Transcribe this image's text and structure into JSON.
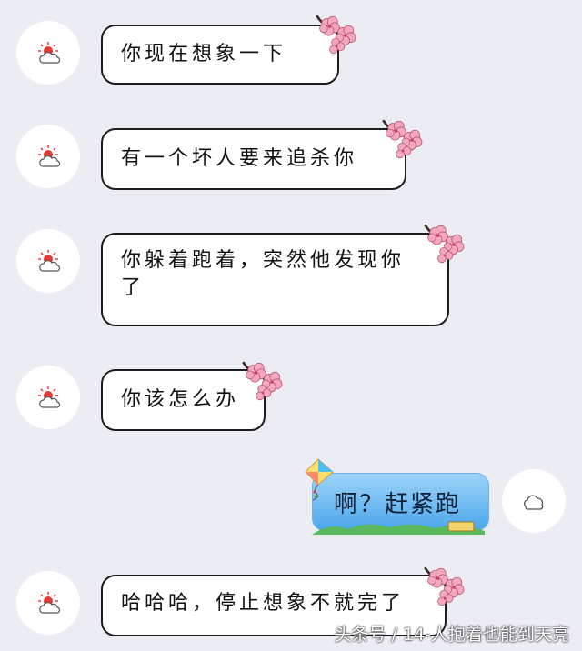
{
  "messages": [
    {
      "side": "received",
      "text": "你现在想象一下",
      "avatar_icon": "sun-cloud-icon"
    },
    {
      "side": "received",
      "text": "有一个坏人要来追杀你",
      "avatar_icon": "sun-cloud-icon"
    },
    {
      "side": "received",
      "text": "你躲着跑着，突然他发现你\n了",
      "avatar_icon": "sun-cloud-icon"
    },
    {
      "side": "received",
      "text": "你该怎么办",
      "avatar_icon": "sun-cloud-icon"
    },
    {
      "side": "sent",
      "text": "啊？赶紧跑",
      "avatar_icon": "cloud-icon"
    },
    {
      "side": "received",
      "text": "哈哈哈，停止想象不就完了",
      "avatar_icon": "sun-cloud-icon"
    }
  ],
  "watermark": "头条号 / 14-人抱着也能到天亮",
  "colors": {
    "background": "#ececf3",
    "bubble_border": "#1d1d1d",
    "sent_bubble": "#4aa6ec",
    "flower": "#f4a7bd"
  }
}
